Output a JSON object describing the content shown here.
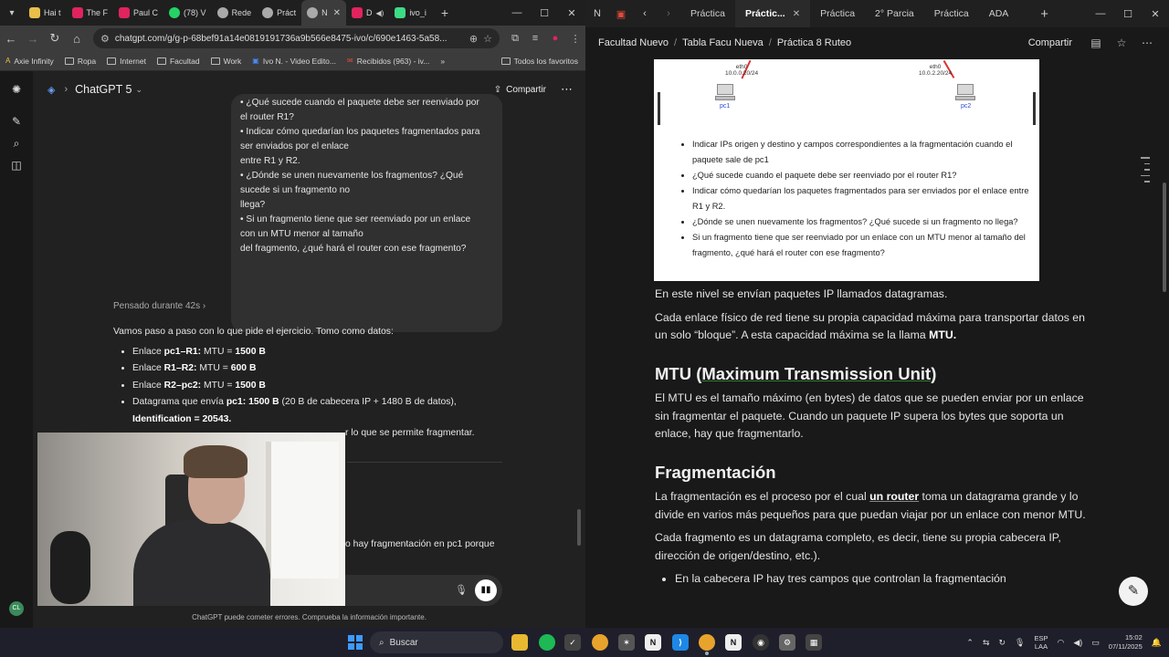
{
  "chrome": {
    "tabs": [
      {
        "label": "Hai t",
        "color": "#e8c04a"
      },
      {
        "label": "The F",
        "color": "#e0245e"
      },
      {
        "label": "Paul C",
        "color": "#e0245e"
      },
      {
        "label": "(78) V",
        "color": "#25d366"
      },
      {
        "label": "Rede",
        "color": "#aaaaaa"
      },
      {
        "label": "Práct",
        "color": "#aaaaaa"
      },
      {
        "label": "N",
        "color": "#aaaaaa"
      },
      {
        "label": "D",
        "color": "#e0245e"
      },
      {
        "label": "ivo_i",
        "color": "#3ddc84"
      }
    ],
    "url": "chatgpt.com/g/g-p-68bef91a14e0819191736a9b566e8475-ivo/c/690e1463-5a58...",
    "bookmarks": [
      "Axie Infinity",
      "Ropa",
      "Internet",
      "Facultad",
      "Work",
      "Ivo N. - Video Edito...",
      "Recibidos (963) - iv..."
    ],
    "all_bookmarks": "Todos los favoritos"
  },
  "gpt": {
    "model": "ChatGPT 5",
    "share": "Compartir",
    "user_message": "• ¿Qué sucede cuando el paquete debe ser reenviado por\nel router R1?\n• Indicar cómo quedarían los paquetes fragmentados para\nser enviados por el enlace\nentre R1 y R2.\n• ¿Dónde se unen nuevamente los fragmentos? ¿Qué\nsucede si un fragmento no\nllega?\n• Si un fragmento tiene que ser reenviado por un enlace\ncon un MTU menor al tamaño\ndel fragmento, ¿qué hará el router con ese fragmento?",
    "thought": "Pensado durante 42s",
    "intro": "Vamos paso a paso con lo que pide el ejercicio. Tomo como datos:",
    "items": [
      {
        "pre": "Enlace ",
        "bold": "pc1–R1:",
        "post": " MTU = ",
        "bold2": "1500 B"
      },
      {
        "pre": "Enlace ",
        "bold": "R1–R2:",
        "post": " MTU = ",
        "bold2": "600 B"
      },
      {
        "pre": "Enlace ",
        "bold": "R2–pc2:",
        "post": " MTU = ",
        "bold2": "1500 B"
      },
      {
        "pre": "Datagrama que envía ",
        "bold": "pc1: 1500 B",
        "post": " (20 B de cabecera IP + 1480 B de datos), ",
        "bold2": "Identification = 20543."
      }
    ],
    "overlap_text": "r lo que se permite fragmentar.",
    "partial_text": "o hay fragmentación en pc1 porque",
    "disclaimer": "ChatGPT puede cometer errores. Comprueba la información importante.",
    "avatar": "CL"
  },
  "notion": {
    "tabs": [
      "Práctica",
      "Práctic...",
      "Práctica",
      "2° Parcia",
      "Práctica",
      "ADA"
    ],
    "breadcrumb": [
      "Facultad Nuevo",
      "Tabla Facu Nueva",
      "Práctica 8 Ruteo"
    ],
    "share": "Compartir",
    "diagram": {
      "eth_left": "eth0\n10.0.0.20/24",
      "eth_right": "eth0\n10.0.2.20/24",
      "pc1": "pc1",
      "pc2": "pc2"
    },
    "image_items": [
      "Indicar IPs origen y destino y campos correspondientes a la fragmentación cuando el paquete sale de pc1",
      "¿Qué sucede cuando el paquete debe ser reenviado por el router R1?",
      "Indicar cómo quedarían los paquetes fragmentados para ser enviados por el enlace entre R1 y R2.",
      "¿Dónde se unen nuevamente los fragmentos? ¿Qué sucede si un fragmento no llega?",
      "Si un fragmento tiene que ser reenviado por un enlace con un MTU menor al tamaño del fragmento, ¿qué hará el router con ese fragmento?"
    ],
    "p1": "En este nivel se envían paquetes IP llamados datagramas.",
    "p2": "Cada enlace físico de red tiene su propia capacidad máxima para transportar datos en un solo “bloque”. A esta capacidad máxima se la llama ",
    "p2_bold": "MTU.",
    "h_mtu_pre": "MTU (",
    "h_mtu_u": "Maximum Transmission Unit",
    "h_mtu_post": ")",
    "p3": "El MTU es el tamaño máximo (en bytes) de datos que se pueden enviar por un enlace sin fragmentar el paquete. Cuando un paquete IP supera los bytes que soporta un enlace, hay que fragmentarlo.",
    "h_frag": "Fragmentación",
    "p4_pre": "La fragmentación es el proceso por el cual ",
    "p4_link": "un router",
    "p4_post": " toma un datagrama grande y lo divide en varios más pequeños para que puedan viajar por un enlace con menor MTU.",
    "p5": "Cada fragmento es un datagrama completo, es decir, tiene su propia cabecera IP, dirección de origen/destino, etc.).",
    "bullet1": "En la cabecera IP hay tres campos que controlan la fragmentación"
  },
  "taskbar": {
    "search": "Buscar",
    "lang": "ESP\nLAA",
    "time": "15:02",
    "date": "07/11/2025"
  }
}
